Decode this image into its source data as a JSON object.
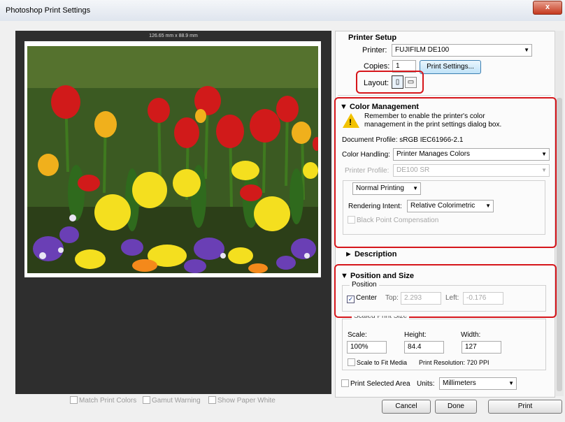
{
  "window": {
    "title": "Photoshop Print Settings",
    "close_glyph": "x"
  },
  "preview": {
    "dimensions": "126.65 mm x 88.9 mm",
    "options": [
      {
        "label": "Match Print Colors",
        "checked": false
      },
      {
        "label": "Gamut Warning",
        "checked": false
      },
      {
        "label": "Show Paper White",
        "checked": false
      }
    ]
  },
  "printer_setup": {
    "heading": "Printer Setup",
    "printer_label": "Printer:",
    "printer_value": "FUJIFILM DE100",
    "copies_label": "Copies:",
    "copies_value": "1",
    "print_settings_button": "Print Settings...",
    "layout_label": "Layout:",
    "layout_icons": [
      "portrait-layout-icon",
      "landscape-layout-icon"
    ]
  },
  "color_management": {
    "heading": "Color Management",
    "warning_line1": "Remember to enable the printer's color",
    "warning_line2": "management in the print settings dialog box.",
    "document_profile": "Document Profile: sRGB IEC61966-2.1",
    "color_handling_label": "Color Handling:",
    "color_handling_value": "Printer Manages Colors",
    "printer_profile_label": "Printer Profile:",
    "printer_profile_value": "DE100 SR",
    "normal_printing": "Normal Printing",
    "rendering_intent_label": "Rendering Intent:",
    "rendering_intent_value": "Relative Colorimetric",
    "black_point": "Black Point Compensation"
  },
  "description": {
    "heading": "Description"
  },
  "position_size": {
    "heading": "Position and Size",
    "position_label": "Position",
    "center_label": "Center",
    "center_checked": true,
    "top_label": "Top:",
    "top_value": "2.293",
    "left_label": "Left:",
    "left_value": "-0.176",
    "scaled_label": "Scaled Print Size",
    "scale_label": "Scale:",
    "scale_value": "100%",
    "height_label": "Height:",
    "height_value": "84.4",
    "width_label": "Width:",
    "width_value": "127",
    "scale_fit": "Scale to Fit Media",
    "resolution": "Print Resolution: 720 PPI"
  },
  "print_selected": {
    "label": "Print Selected Area",
    "units_label": "Units:",
    "units_value": "Millimeters"
  },
  "buttons": {
    "cancel": "Cancel",
    "done": "Done",
    "print": "Print"
  },
  "colors": {
    "highlight": "#d6161b",
    "preview_bg": "#2e2e2e"
  }
}
